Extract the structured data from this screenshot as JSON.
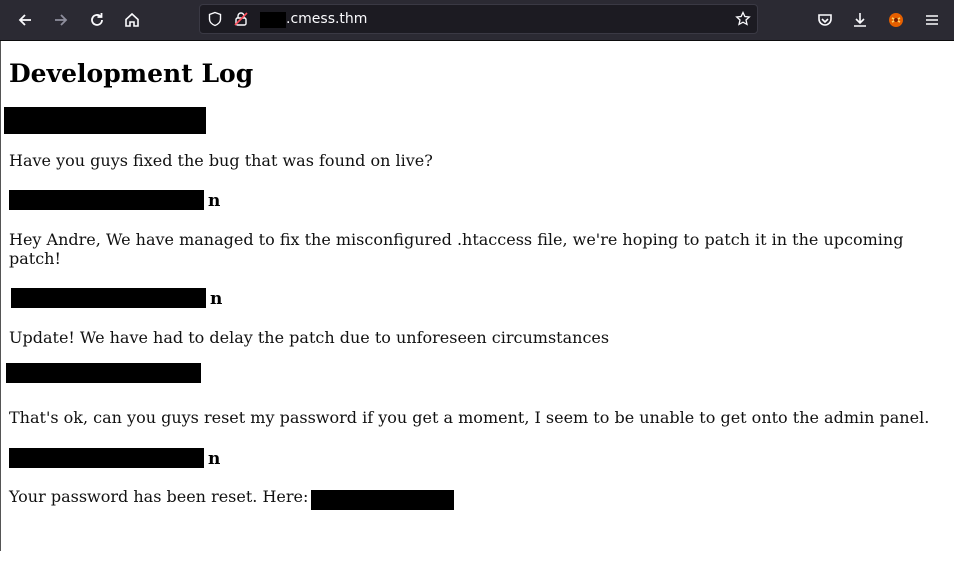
{
  "browser": {
    "url_suffix": ".cmess.thm",
    "icons": {
      "back": "back-arrow-icon",
      "forward": "forward-arrow-icon",
      "reload": "reload-icon",
      "home": "home-icon",
      "shield": "tracking-shield-icon",
      "lock": "lock-icon",
      "bookmark": "star-icon",
      "pocket": "pocket-icon",
      "download": "download-icon",
      "extension": "extension-icon",
      "menu": "hamburger-menu-icon"
    }
  },
  "page": {
    "title": "Development Log",
    "entries": [
      {
        "author_suffix": "",
        "message": "Have you guys fixed the bug that was found on live?"
      },
      {
        "author_suffix": "n",
        "message": "Hey Andre, We have managed to fix the misconfigured .htaccess file, we're hoping to patch it in the upcoming patch!"
      },
      {
        "author_suffix": "n",
        "message": "Update! We have had to delay the patch due to unforeseen circumstances"
      },
      {
        "author_suffix": "",
        "message": "That's ok, can you guys reset my password if you get a moment, I seem to be unable to get onto the admin panel."
      },
      {
        "author_suffix": "n",
        "message": "Your password has been reset. Here: "
      }
    ]
  }
}
